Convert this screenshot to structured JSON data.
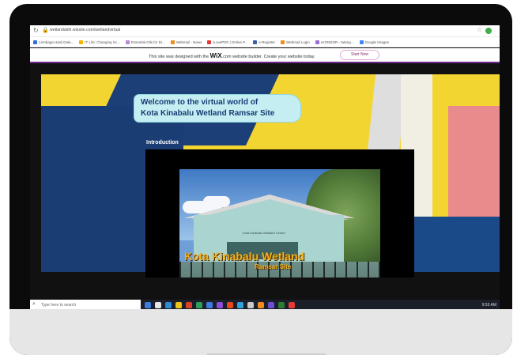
{
  "browser": {
    "url": "wetlandsbhi.wixsite.com/wetlandvirtual",
    "bookmarks": [
      {
        "label": "Lembaga Hasil Dala...",
        "color": "#2f6fd6"
      },
      {
        "label": "IT Life: Changing Sc...",
        "color": "#f5b400"
      },
      {
        "label": "Essential Oils for Di...",
        "color": "#b98ad6"
      },
      {
        "label": "Webmail - News",
        "color": "#f28c1f"
      },
      {
        "label": "iLovePDF | Online P...",
        "color": "#e53935"
      },
      {
        "label": "e-Register",
        "color": "#3a5da8"
      },
      {
        "label": "Webmail Login",
        "color": "#f28c1f"
      },
      {
        "label": "ezONDOR - tatang...",
        "color": "#9c6bd9"
      },
      {
        "label": "Google Images",
        "color": "#4285f4"
      }
    ]
  },
  "wix_banner": {
    "message_pre": "This site was designed with the ",
    "brand": "WiX",
    "message_post": ".com website builder. Create your website today.",
    "button_label": "Start Now"
  },
  "site": {
    "welcome_line1": "Welcome to the virtual world of",
    "welcome_line2": "Kota Kinabalu Wetland Ramsar Site",
    "section_title": "Introduction",
    "video": {
      "overlay_title": "Kota Kinabalu Wetland",
      "overlay_subtitle": "Ramsar Site",
      "building_sign": "Kota Kinabalu Wetland Centre"
    }
  },
  "taskbar": {
    "search_placeholder": "Type here to search",
    "time": "9:55 AM",
    "icon_colors": [
      "#3d7be0",
      "#e6e6e6",
      "#2b8bd6",
      "#f0c419",
      "#d9402b",
      "#2f9e59",
      "#3d7be0",
      "#8a4fd6",
      "#e64a19",
      "#33a0d9",
      "#c9c9c9",
      "#f28c1f",
      "#6b4fd6",
      "#2e7d32",
      "#e53935"
    ]
  },
  "colors": {
    "wix_accent": "#6b2b8c",
    "welcome_bg": "#c5eef3",
    "welcome_text": "#153c73"
  }
}
